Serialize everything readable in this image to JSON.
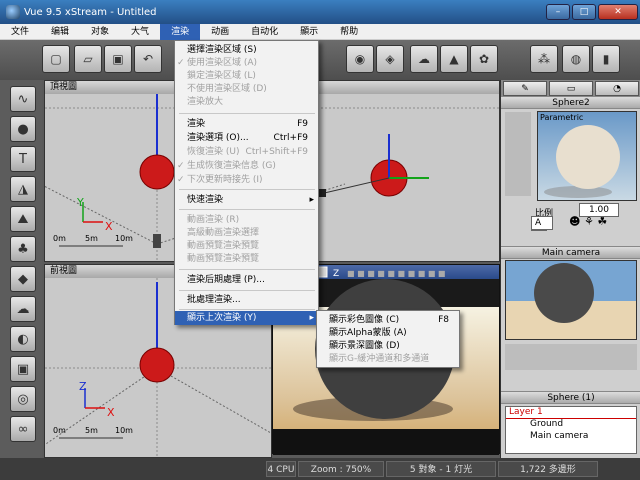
{
  "window": {
    "title": "Vue 9.5 xStream - Untitled",
    "minimize": "–",
    "maximize": "□",
    "close": "✕"
  },
  "menubar": [
    "文件",
    "编辑",
    "对象",
    "大气",
    "渲染",
    "动画",
    "自动化",
    "顯示",
    "帮助"
  ],
  "menubar_active_index": 4,
  "viewports": {
    "top": {
      "title": "頂視圖",
      "scale_labels": [
        "0m",
        "5m",
        "10m"
      ],
      "axis_x": "X",
      "axis_y": "Y"
    },
    "front": {
      "title": "前視圖",
      "scale_labels": [
        "0m",
        "5m",
        "10m"
      ],
      "axis_x": "X",
      "axis_z": "Z"
    }
  },
  "render_menu": {
    "items": [
      {
        "label": "選擇渲染区域 (S)",
        "disabled": false
      },
      {
        "label": "使用渲染区域 (A)",
        "disabled": true,
        "checked": true
      },
      {
        "label": "鎖定渲染区域 (L)",
        "disabled": true
      },
      {
        "label": "不使用渲染区域 (D)",
        "disabled": true
      },
      {
        "label": "渲染放大",
        "disabled": true
      },
      {
        "label": "渲染",
        "shortcut": "F9",
        "disabled": false
      },
      {
        "label": "渲染選項 (O)...",
        "shortcut": "Ctrl+F9",
        "disabled": false
      },
      {
        "label": "恢復渲染 (U)",
        "shortcut": "Ctrl+Shift+F9",
        "disabled": true
      },
      {
        "label": "生成恢復渲染信息 (G)",
        "disabled": true,
        "checked": true
      },
      {
        "label": "下次更新時接先 (I)",
        "disabled": true,
        "checked": true
      },
      {
        "label": "快速渲染",
        "disabled": false,
        "submenu": true
      },
      {
        "label": "動画渲染 (R)",
        "disabled": true
      },
      {
        "label": "高級動画渲染選擇",
        "disabled": true
      },
      {
        "label": "動画預覽渲染預覽",
        "disabled": true
      },
      {
        "label": "動画預覽渲染預覽",
        "disabled": true
      },
      {
        "label": "渲染后期處理 (P)...",
        "disabled": false
      },
      {
        "label": "批處理渲染...",
        "disabled": false
      },
      {
        "label": "顯示上次渲染 (Y)",
        "disabled": false,
        "submenu": true,
        "highlighted": true
      }
    ]
  },
  "submenu": {
    "items": [
      {
        "label": "顯示彩色圖像 (C)",
        "shortcut": "F8",
        "disabled": false
      },
      {
        "label": "顯示Alpha蒙版 (A)",
        "disabled": false
      },
      {
        "label": "顯示景深圖像 (D)",
        "disabled": false
      },
      {
        "label": "顯示G-緩沖通道和多通道",
        "disabled": true
      }
    ]
  },
  "right_panel": {
    "object_name": "Sphere2",
    "material_name": "Parametric",
    "scale_label": "比例",
    "scale_value": "1.00",
    "layer_select": "A",
    "camera_header": "Main camera",
    "objects_header": "Sphere (1)",
    "layers": [
      {
        "label": "Layer 1",
        "color": "#cc0000"
      },
      {
        "label": "Ground",
        "color": "#000000"
      },
      {
        "label": "Main camera",
        "color": "#000000"
      }
    ]
  },
  "status": {
    "cpu": "4 CPU",
    "zoom": "Zoom : 750%",
    "objects": "5 對象 - 1 灯光",
    "polygons": "1,722 多邊形"
  },
  "colors": {
    "menu_highlight": "#2f61b4",
    "sphere": "#cc1a1a",
    "axis_blue": "#1a2fd0",
    "axis_green": "#13a31a",
    "axis_red": "#d11"
  }
}
